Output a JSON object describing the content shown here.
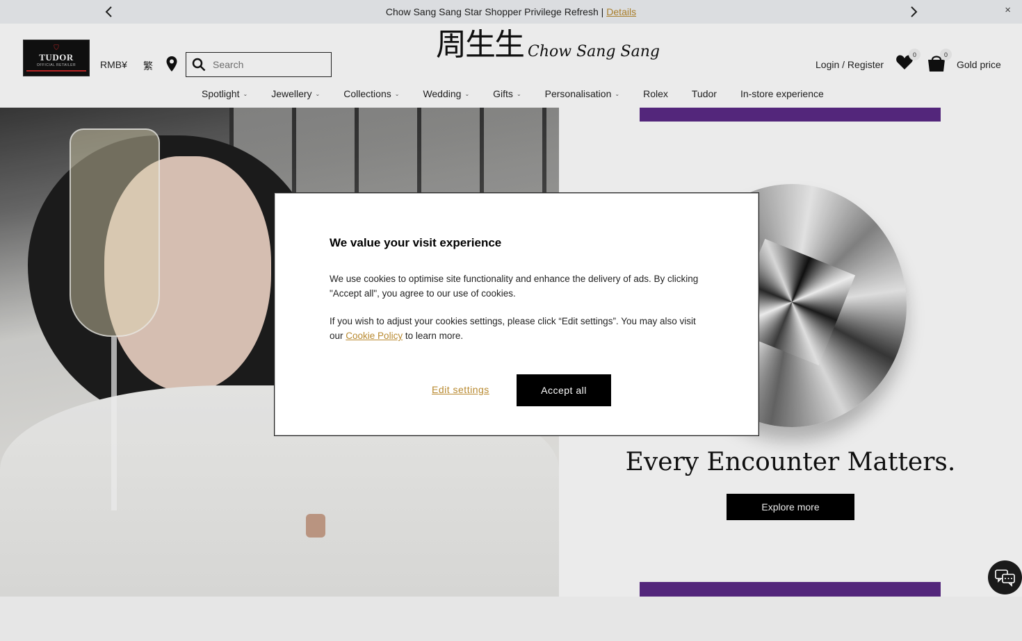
{
  "announcement": {
    "text": "Chow Sang Sang Star Shopper Privilege Refresh |",
    "link": "Details",
    "close": "×"
  },
  "header": {
    "tudor": {
      "line1": "TUDOR",
      "line2": "OFFICIAL RETAILER"
    },
    "currency": "RMB¥",
    "language": "繁",
    "search_placeholder": "Search",
    "logo_cn": "周生生",
    "logo_en": "Chow Sang Sang",
    "login": "Login / Register",
    "wishlist_count": "0",
    "cart_count": "0",
    "gold_price": "Gold price"
  },
  "nav": {
    "items": [
      {
        "label": "Spotlight",
        "dropdown": true
      },
      {
        "label": "Jewellery",
        "dropdown": true
      },
      {
        "label": "Collections",
        "dropdown": true
      },
      {
        "label": "Wedding",
        "dropdown": true
      },
      {
        "label": "Gifts",
        "dropdown": true
      },
      {
        "label": "Personalisation",
        "dropdown": true
      },
      {
        "label": "Rolex",
        "dropdown": false
      },
      {
        "label": "Tudor",
        "dropdown": false
      },
      {
        "label": "In-store experience",
        "dropdown": false
      }
    ]
  },
  "hero": {
    "tagline": "Every Encounter Matters.",
    "cta": "Explore more"
  },
  "cookie_modal": {
    "title": "We value your visit experience",
    "para1": "We use cookies to optimise site functionality and enhance the delivery of ads. By clicking \"Accept all\", you agree to our use of cookies.",
    "para2_prefix": "If you wish to adjust your cookies settings, please click “Edit settings”. You may also visit our",
    "para2_link": "Cookie Policy",
    "para2_suffix": "to learn more.",
    "edit_label": "Edit settings",
    "accept_label": "Accept all"
  },
  "colors": {
    "accent_gold": "#b8892f",
    "purple_band": "#5b2a86",
    "button_black": "#000000"
  }
}
